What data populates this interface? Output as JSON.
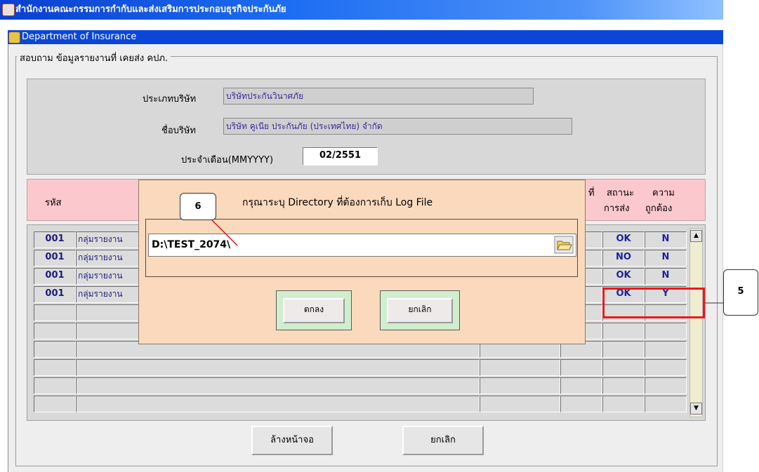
{
  "window": {
    "title": "สำนักงานคณะกรรมการกำกับและส่งเสริมการประกอบธุรกิจประกันภัย",
    "subtitle": "Department of Insurance"
  },
  "form": {
    "legend": "สอบถาม ข้อมูลรายงานที่ เคยส่ง คปภ.",
    "company_type_label": "ประเภทบริษัท",
    "company_type_value": "บริษัทประกันวินาศภัย",
    "company_name_label": "ชื่อบริษัท",
    "company_name_value": "บริษัท คูเนีย ประกันภัย (ประเทศไทย) จำกัด",
    "month_label": "ประจำเดือน(MMYYYY)",
    "month_value": "02/2551"
  },
  "table": {
    "headers": {
      "code": "รหัส",
      "partial": "ที่",
      "status_line1": "สถานะ",
      "status_line2": "การส่ง",
      "valid_line1": "ความ",
      "valid_line2": "ถูกต้อง"
    },
    "rows": [
      {
        "code": "001",
        "name": "กลุ่มรายงาน",
        "status": "OK",
        "valid": "N"
      },
      {
        "code": "001",
        "name": "กลุ่มรายงาน",
        "status": "NO",
        "valid": "N"
      },
      {
        "code": "001",
        "name": "กลุ่มรายงาน",
        "status": "OK",
        "valid": "N"
      },
      {
        "code": "001",
        "name": "กลุ่มรายงาน",
        "status": "OK",
        "valid": "Y"
      }
    ]
  },
  "buttons": {
    "clear": "ล้างหน้าจอ",
    "cancel": "ยกเลิก"
  },
  "dialog": {
    "message": "กรุณาระบุ Directory ที่ต้องการเก็บ Log File",
    "directory_value": "D:\\TEST_2074\\",
    "ok": "ตกลง",
    "cancel": "ยกเลิก"
  },
  "callouts": {
    "step6": "6",
    "step5": "5"
  },
  "colors": {
    "titlebar": "#1d6df2",
    "header_band": "#fac8cd",
    "dialog": "#fbd9bd",
    "highlight": "#ea1a1a"
  }
}
